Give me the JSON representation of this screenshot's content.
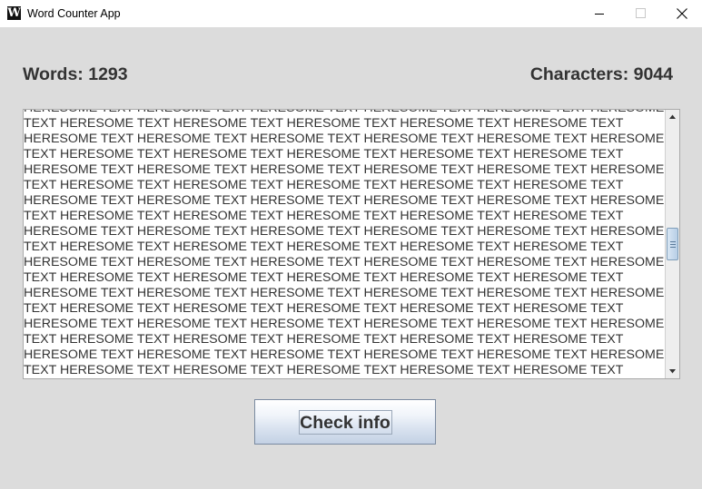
{
  "window": {
    "title": "Word Counter App",
    "icon_letter": "W",
    "controls": [
      "minimize",
      "maximize",
      "close"
    ]
  },
  "stats": {
    "words": "Words: 1293",
    "characters": "Characters: 9044"
  },
  "text_area": {
    "lines": [
      "HERESOME TEXT HERESOME TEXT HERESOME TEXT HERESOME TEXT HERESOME TEXT HERESOME",
      "TEXT HERESOME TEXT HERESOME TEXT HERESOME TEXT HERESOME TEXT HERESOME TEXT",
      "HERESOME TEXT HERESOME TEXT HERESOME TEXT HERESOME TEXT HERESOME TEXT HERESOME",
      "TEXT HERESOME TEXT HERESOME TEXT HERESOME TEXT HERESOME TEXT HERESOME TEXT",
      "HERESOME TEXT HERESOME TEXT HERESOME TEXT HERESOME TEXT HERESOME TEXT HERESOME",
      "TEXT HERESOME TEXT HERESOME TEXT HERESOME TEXT HERESOME TEXT HERESOME TEXT",
      "HERESOME TEXT HERESOME TEXT HERESOME TEXT HERESOME TEXT HERESOME TEXT HERESOME",
      "TEXT HERESOME TEXT HERESOME TEXT HERESOME TEXT HERESOME TEXT HERESOME TEXT",
      "HERESOME TEXT HERESOME TEXT HERESOME TEXT HERESOME TEXT HERESOME TEXT HERESOME",
      "TEXT HERESOME TEXT HERESOME TEXT HERESOME TEXT HERESOME TEXT HERESOME TEXT",
      "HERESOME TEXT HERESOME TEXT HERESOME TEXT HERESOME TEXT HERESOME TEXT HERESOME",
      "TEXT HERESOME TEXT HERESOME TEXT HERESOME TEXT HERESOME TEXT HERESOME TEXT",
      "HERESOME TEXT HERESOME TEXT HERESOME TEXT HERESOME TEXT HERESOME TEXT HERESOME",
      "TEXT HERESOME TEXT HERESOME TEXT HERESOME TEXT HERESOME TEXT HERESOME TEXT",
      "HERESOME TEXT HERESOME TEXT HERESOME TEXT HERESOME TEXT HERESOME TEXT HERESOME",
      "TEXT HERESOME TEXT HERESOME TEXT HERESOME TEXT HERESOME TEXT HERESOME TEXT",
      "HERESOME TEXT HERESOME TEXT HERESOME TEXT HERESOME TEXT HERESOME TEXT HERESOME",
      "TEXT HERESOME TEXT HERESOME TEXT HERESOME TEXT HERESOME TEXT HERESOME TEXT"
    ],
    "scroll_position": 0.5
  },
  "actions": {
    "check_label": "Check info"
  },
  "colors": {
    "window_bg": "#dcdcdc",
    "text": "#333333",
    "button_border": "#7a8aa0",
    "scroll_thumb": "#b8cfe6"
  }
}
